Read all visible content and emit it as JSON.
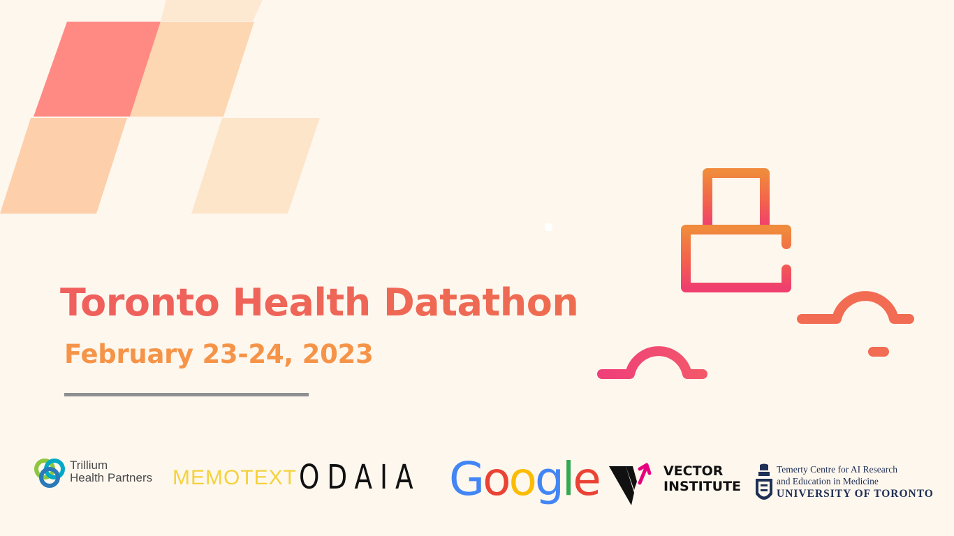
{
  "event": {
    "title": "Toronto Health Datathon",
    "date": "February 23-24, 2023"
  },
  "sponsors": {
    "trillium": {
      "line1": "Trillium",
      "line2": "Health Partners",
      "icon": "trillium-knot-icon"
    },
    "memotext": {
      "name": "MEMOTEXT"
    },
    "odaia": {
      "name": "ODAIA"
    },
    "google": {
      "letters": [
        "G",
        "o",
        "o",
        "g",
        "l",
        "e"
      ],
      "colors": [
        "#4285f4",
        "#ea4335",
        "#fbbc05",
        "#4285f4",
        "#34a853",
        "#ea4335"
      ]
    },
    "vector": {
      "line1": "VECTOR",
      "line2": "INSTITUTE",
      "icon": "vector-v-arrow-icon"
    },
    "uoft": {
      "line1": "Temerty Centre for AI Research",
      "line2": "and Education in Medicine",
      "line3": "UNIVERSITY OF TORONTO",
      "icon": "uoft-crest-icon"
    }
  },
  "colors": {
    "background": "#fef7ee",
    "title": "#ef5f5e",
    "date": "#f59448",
    "tower_top": "#f08a3c",
    "tower_bottom": "#ef3f6e"
  }
}
